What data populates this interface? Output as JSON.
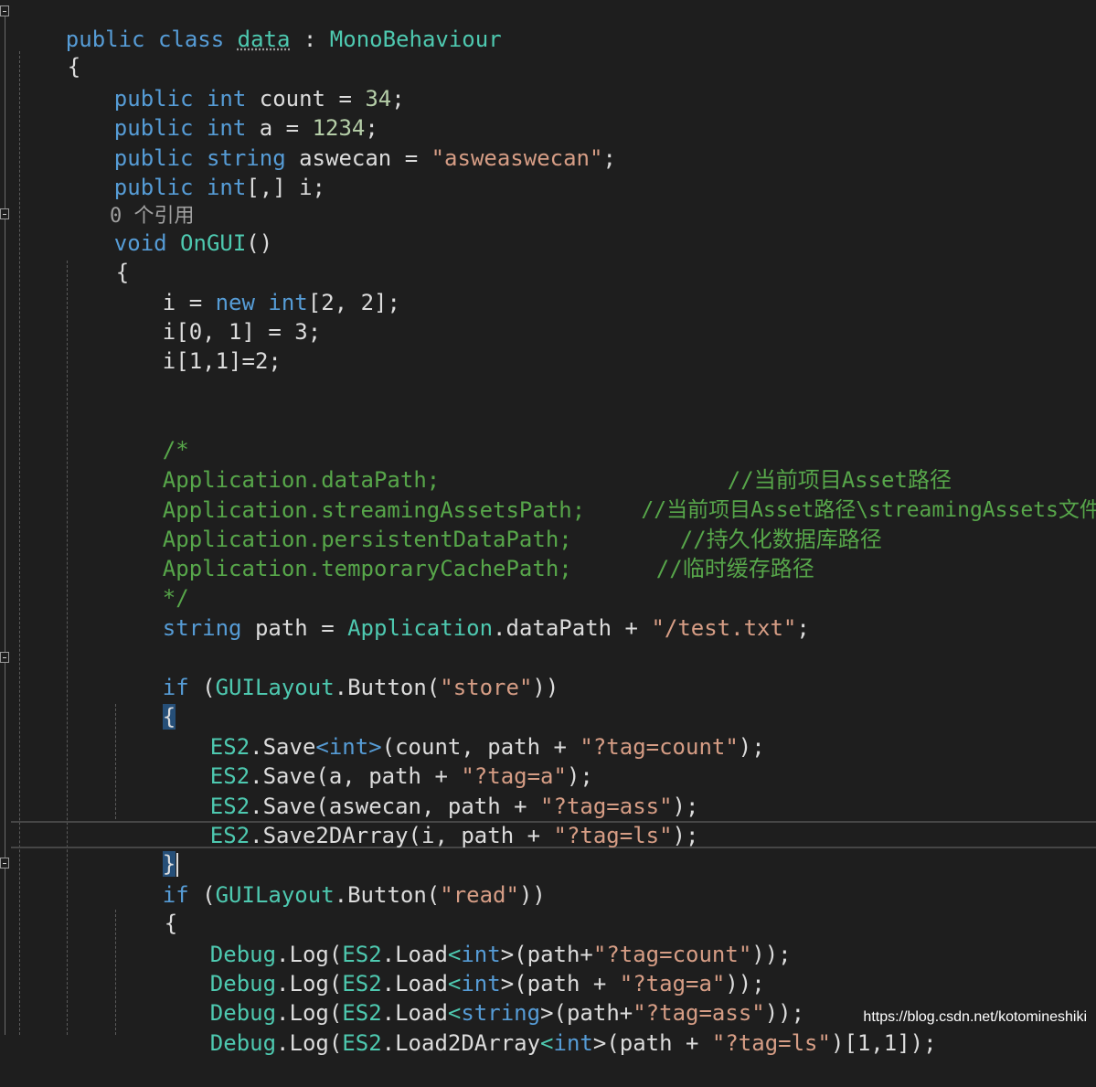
{
  "code": {
    "class_decl": {
      "kw": "public class",
      "name": "data",
      "sep": " : ",
      "base": "MonoBehaviour"
    },
    "open_brace_class": "{",
    "fields": [
      {
        "kw": "public",
        "type": "int",
        "rest": " count = ",
        "num": "34",
        "end": ";"
      },
      {
        "kw": "public",
        "type": "int",
        "rest": " a = ",
        "num": "1234",
        "end": ";"
      },
      {
        "kw": "public",
        "type": "string",
        "rest": " aswecan = ",
        "str": "\"asweaswecan\"",
        "end": ";"
      },
      {
        "kw": "public",
        "type": "int",
        "rest": "[,] i;"
      }
    ],
    "references_hint": "0 个引用",
    "method_decl": {
      "kw": "void",
      "name": "OnGUI",
      "parens": "()"
    },
    "open_brace_method": "{",
    "init_lines": [
      {
        "p1": "i = ",
        "kw": "new",
        "type": "int",
        "p2": "[2, 2];"
      },
      {
        "text": "i[0, 1] = 3;"
      },
      {
        "text": "i[1,1]=2;"
      }
    ],
    "comment_block": [
      {
        "code": "/*",
        "note": ""
      },
      {
        "code": "Application.dataPath;",
        "note": "//当前项目Asset路径"
      },
      {
        "code": "Application.streamingAssetsPath;",
        "note": "//当前项目Asset路径\\streamingAssets文件夹"
      },
      {
        "code": "Application.persistentDataPath;",
        "note": "//持久化数据库路径"
      },
      {
        "code": "Application.temporaryCachePath;",
        "note": "//临时缓存路径"
      },
      {
        "code": "*/",
        "note": ""
      }
    ],
    "path_line": {
      "kw": "string",
      "mid": " path = ",
      "type": "Application",
      "rest": ".dataPath + ",
      "str": "\"/test.txt\"",
      "end": ";"
    },
    "if_store": {
      "kw": "if",
      "open": " (",
      "type": "GUILayout",
      "call": ".Button(",
      "str": "\"store\"",
      "close": "))"
    },
    "store_open": "{",
    "store_lines": [
      {
        "type": "ES2",
        "call": ".Save",
        "generic": "<int>",
        "args": "(count, path + ",
        "str": "\"?tag=count\"",
        "end": ");"
      },
      {
        "type": "ES2",
        "call": ".Save",
        "generic": "",
        "args": "(a, path + ",
        "str": "\"?tag=a\"",
        "end": ");"
      },
      {
        "type": "ES2",
        "call": ".Save",
        "generic": "",
        "args": "(aswecan, path + ",
        "str": "\"?tag=ass\"",
        "end": ");"
      },
      {
        "type": "ES2",
        "call": ".Save2DArray",
        "generic": "",
        "args": "(i, path + ",
        "str": "\"?tag=ls\"",
        "end": ");"
      }
    ],
    "store_close": "}",
    "if_read": {
      "kw": "if",
      "open": " (",
      "type": "GUILayout",
      "call": ".Button(",
      "str": "\"read\"",
      "close": "))"
    },
    "read_open": "{",
    "read_lines": [
      {
        "type": "Debug",
        "log": ".Log(",
        "type2": "ES2",
        "load": ".Load",
        "lt": "<",
        "gen": "int",
        "gt": ">",
        "args": "(path+",
        "str": "\"?tag=count\"",
        "end": "));"
      },
      {
        "type": "Debug",
        "log": ".Log(",
        "type2": "ES2",
        "load": ".Load",
        "lt": "<",
        "gen": "int",
        "gt": ">",
        "args": "(path + ",
        "str": "\"?tag=a\"",
        "end": "));"
      },
      {
        "type": "Debug",
        "log": ".Log(",
        "type2": "ES2",
        "load": ".Load",
        "lt": "<",
        "gen": "string",
        "gt": ">",
        "args": "(path+",
        "str": "\"?tag=ass\"",
        "end": "));"
      },
      {
        "type": "Debug",
        "log": ".Log(",
        "type2": "ES2",
        "load": ".Load2DArray",
        "lt": "<",
        "gen": "int",
        "gt": ">",
        "args": "(path + ",
        "str": "\"?tag=ls\"",
        "end": ")[1,1]);"
      }
    ]
  },
  "watermark": "https://blog.csdn.net/kotomineshiki",
  "colors": {
    "background": "#1e1e1e",
    "keyword": "#569cd6",
    "type": "#4ec9b0",
    "string": "#d69d85",
    "number": "#b5cea8",
    "comment": "#57a64a",
    "text": "#dcdcdc"
  }
}
